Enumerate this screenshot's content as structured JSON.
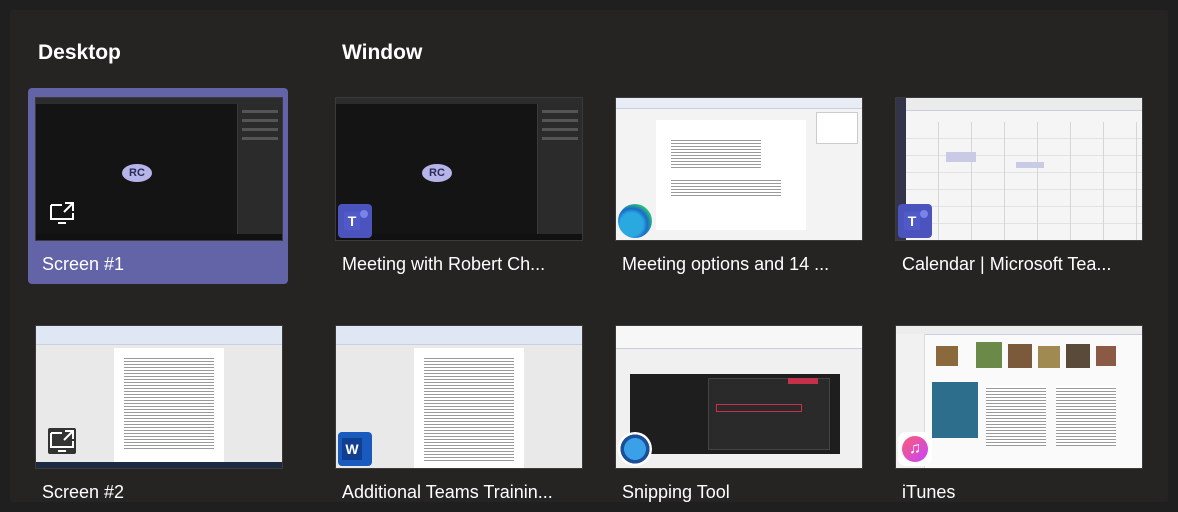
{
  "sections": {
    "desktop": "Desktop",
    "window": "Window"
  },
  "tiles": [
    {
      "label": "Screen #1",
      "thumb_icon": "share-screen-icon",
      "selected": true
    },
    {
      "label": "Meeting with Robert Ch...",
      "thumb_icon": "teams-icon",
      "avatar": "RC"
    },
    {
      "label": "Meeting options and 14 ...",
      "thumb_icon": "edge-icon"
    },
    {
      "label": "Calendar | Microsoft Tea...",
      "thumb_icon": "teams-icon"
    },
    {
      "label": "Screen #2",
      "thumb_icon": "share-screen-icon"
    },
    {
      "label": "Additional Teams Trainin...",
      "thumb_icon": "word-icon",
      "word_letter": "W"
    },
    {
      "label": "Snipping Tool",
      "thumb_icon": "snipping-tool-icon"
    },
    {
      "label": "iTunes",
      "thumb_icon": "itunes-icon"
    }
  ],
  "screen1_avatar": "RC",
  "colors": {
    "background": "#252423",
    "selected": "#6264a7",
    "teams": "#4b53bc"
  }
}
